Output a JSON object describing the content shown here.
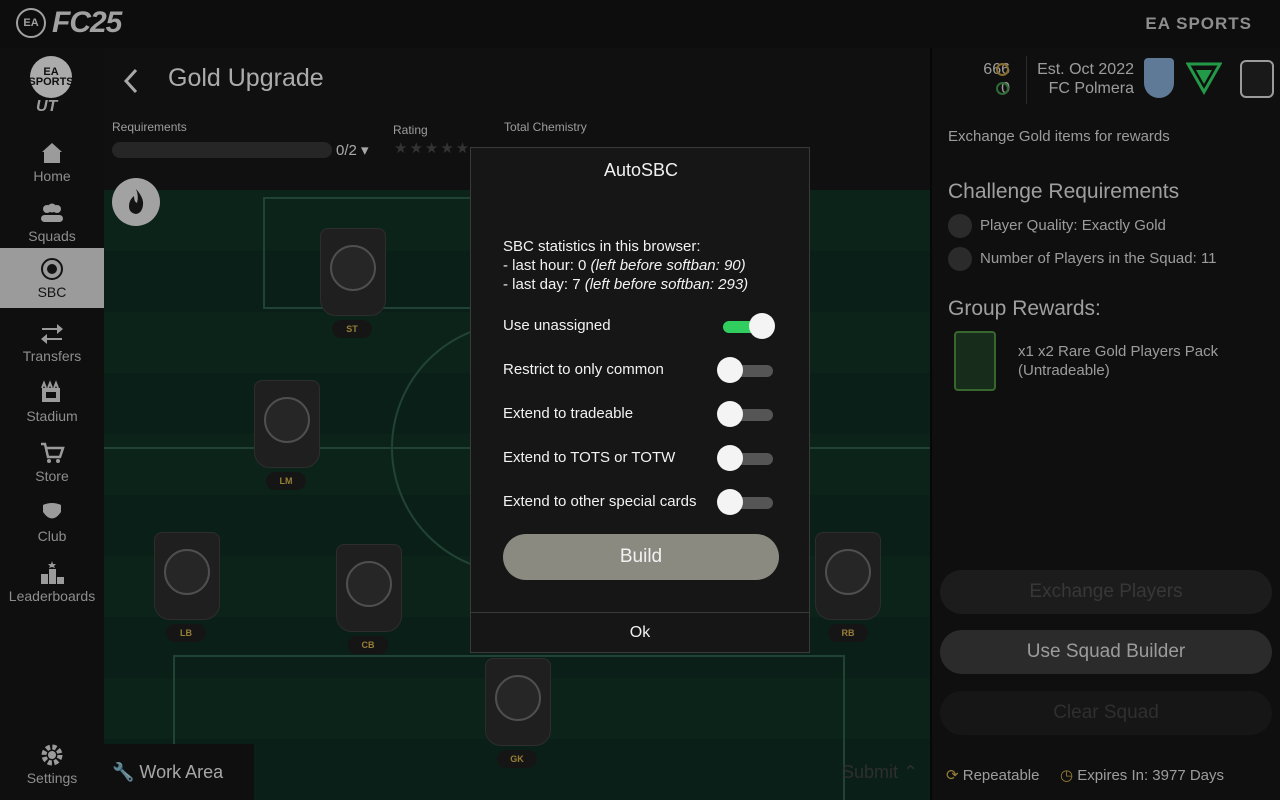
{
  "topbar": {
    "ea_label": "EA",
    "game_title": "FC25",
    "publisher": "EA SPORTS"
  },
  "sidebar": {
    "logo_text": "EA SPORTS",
    "ut_text": "UT",
    "items": [
      {
        "label": "Home",
        "icon": "home-icon"
      },
      {
        "label": "Squads",
        "icon": "squads-icon"
      },
      {
        "label": "SBC",
        "icon": "sbc-icon",
        "active": true
      },
      {
        "label": "Transfers",
        "icon": "transfers-icon"
      },
      {
        "label": "Stadium",
        "icon": "stadium-icon"
      },
      {
        "label": "Store",
        "icon": "store-icon"
      },
      {
        "label": "Club",
        "icon": "club-icon"
      },
      {
        "label": "Leaderboards",
        "icon": "leaderboards-icon"
      }
    ],
    "settings_label": "Settings"
  },
  "header": {
    "title": "Gold Upgrade",
    "requirements_label": "Requirements",
    "requirements_count": "0/2",
    "rating_label": "Rating",
    "chemistry_label": "Total Chemistry"
  },
  "pitch": {
    "positions": [
      "ST",
      "LM",
      "LB",
      "CB",
      "RB",
      "GK"
    ],
    "work_area_label": "Work Area",
    "submit_label": "Submit"
  },
  "account": {
    "coins": "666",
    "points": "0",
    "established": "Est. Oct 2022",
    "club_name": "FC Polmera"
  },
  "right_panel": {
    "description": "Exchange Gold items for rewards",
    "challenge_heading": "Challenge Requirements",
    "requirements": [
      "Player Quality: Exactly Gold",
      "Number of Players in the Squad: 11"
    ],
    "rewards_heading": "Group Rewards:",
    "reward_line1": "x1 x2 Rare Gold Players Pack",
    "reward_line2": "(Untradeable)",
    "exchange_label": "Exchange Players",
    "squad_builder_label": "Use Squad Builder",
    "clear_label": "Clear Squad",
    "repeatable_label": "Repeatable",
    "expires_label": "Expires In: 3977 Days"
  },
  "modal": {
    "title": "AutoSBC",
    "stats_heading": "SBC statistics in this browser:",
    "last_hour": "- last hour: 0",
    "last_hour_note": "(left before softban: 90)",
    "last_day": "- last day: 7",
    "last_day_note": "(left before softban: 293)",
    "options": [
      {
        "label": "Use unassigned",
        "on": true
      },
      {
        "label": "Restrict to only common",
        "on": false
      },
      {
        "label": "Extend to tradeable",
        "on": false
      },
      {
        "label": "Extend to TOTS or TOTW",
        "on": false
      },
      {
        "label": "Extend to other special cards",
        "on": false
      }
    ],
    "build_label": "Build",
    "ok_label": "Ok"
  },
  "colors": {
    "toggle_on": "#2fce5f",
    "toggle_off": "#555555",
    "build_button": "#8a8a80",
    "position_text": "#c8a94a"
  }
}
